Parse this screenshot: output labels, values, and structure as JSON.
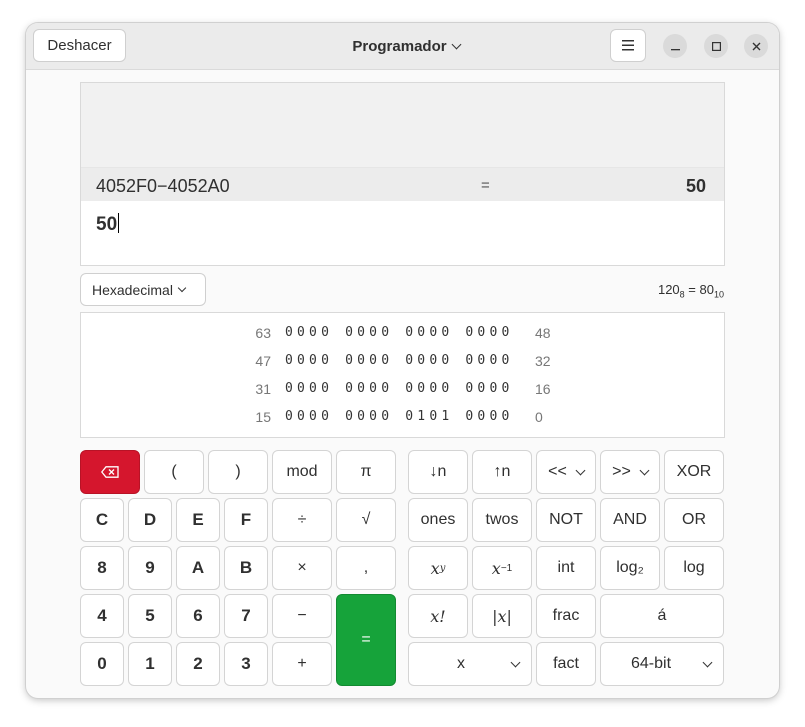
{
  "header": {
    "undo_label": "Deshacer",
    "mode_title": "Programador",
    "menu_icon": "hamburger-icon",
    "window_controls": [
      "minimize-icon",
      "maximize-icon",
      "close-icon"
    ]
  },
  "history": {
    "expression": "4052F0−4052A0",
    "equals": "=",
    "result": "50"
  },
  "entry": {
    "value": "50"
  },
  "base": {
    "selected": "Hexadecimal",
    "conversion_a": "120",
    "conversion_a_sub": "8",
    "conversion_eq": " = ",
    "conversion_b": "80",
    "conversion_b_sub": "10"
  },
  "bits": {
    "rows": [
      {
        "left": "63",
        "groups": "0000 0000 0000 0000",
        "right": "48"
      },
      {
        "left": "47",
        "groups": "0000 0000 0000 0000",
        "right": "32"
      },
      {
        "left": "31",
        "groups": "0000 0000 0000 0000",
        "right": "16"
      },
      {
        "left": "15",
        "groups": "0000 0000 0101 0000",
        "right": "0"
      }
    ]
  },
  "keys": {
    "backspace_icon": "backspace-icon",
    "open_paren": "(",
    "close_paren": ")",
    "mod": "mod",
    "pi": "π",
    "shift_down": "↓n",
    "shift_up": "↑n",
    "shl": "<<",
    "shr": ">>",
    "xor": "XOR",
    "c": "C",
    "d": "D",
    "e": "E",
    "f": "F",
    "divide": "÷",
    "sqrt": "√",
    "ones": "ones",
    "twos": "twos",
    "not": "NOT",
    "and": "AND",
    "or": "OR",
    "n8": "8",
    "n9": "9",
    "a": "A",
    "b": "B",
    "multiply": "×",
    "comma": ",",
    "power_base": "x",
    "power_exp": "y",
    "inverse_base": "x",
    "inverse_exp": "−1",
    "int": "int",
    "log2": "log₂",
    "log": "log",
    "n4": "4",
    "n5": "5",
    "n6": "6",
    "n7": "7",
    "minus": "−",
    "equals": "=",
    "factorial": "x!",
    "abs": "|x|",
    "frac": "frac",
    "char": "á",
    "n0": "0",
    "n1": "1",
    "n2": "2",
    "n3": "3",
    "plus": "+",
    "x_select": "x",
    "fact": "fact",
    "word_size": "64-bit"
  }
}
